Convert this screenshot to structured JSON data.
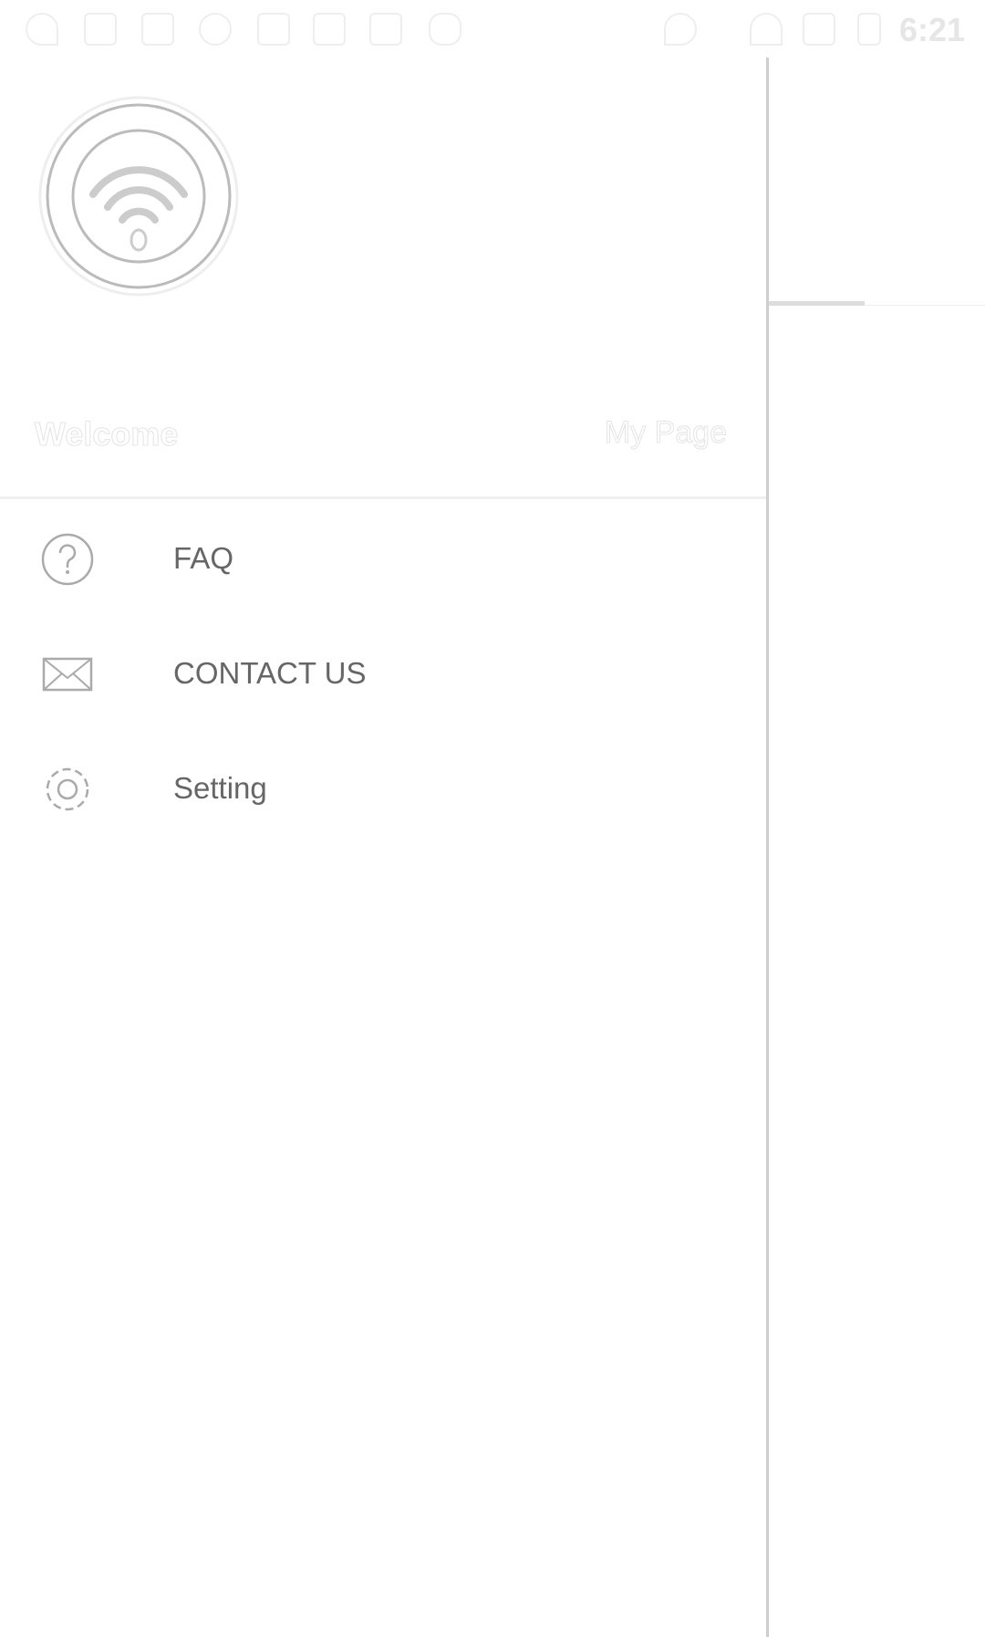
{
  "status_bar": {
    "time": "6:21",
    "left_icons": [
      "wifi-question-icon",
      "facebook-icon",
      "tools-icon",
      "info-icon",
      "lock-icon",
      "bag-check-icon",
      "bag-play-icon",
      "android-icon"
    ],
    "right_icons": [
      "location-icon",
      "bluetooth-icon",
      "wifi-icon",
      "no-signal-icon",
      "battery-charging-icon"
    ]
  },
  "drawer": {
    "header": {
      "welcome": "Welcome",
      "my_page": "My Page"
    },
    "items": [
      {
        "label": "FAQ",
        "icon": "question-circle-icon"
      },
      {
        "label": "CONTACT US",
        "icon": "envelope-icon"
      },
      {
        "label": "Setting",
        "icon": "gear-icon"
      }
    ]
  }
}
